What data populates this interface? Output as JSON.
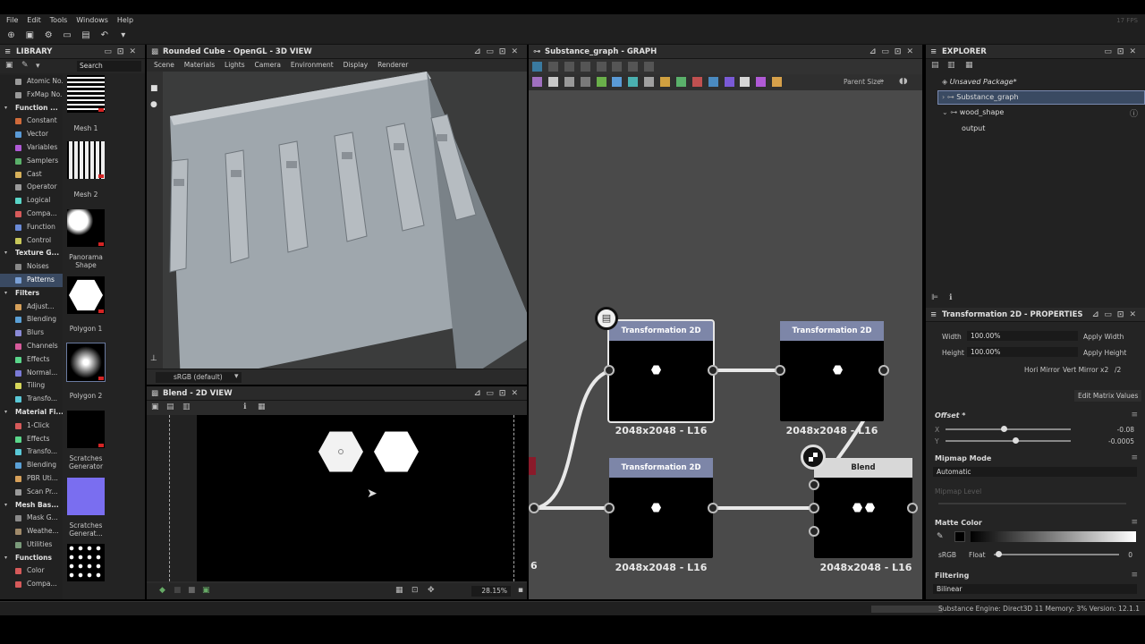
{
  "app": {
    "fps": "17 FPS"
  },
  "menu": [
    "File",
    "Edit",
    "Tools",
    "Windows",
    "Help"
  ],
  "library": {
    "title": "LIBRARY",
    "search_placeholder": "Search",
    "tree": [
      {
        "label": "Atomic No...",
        "type": "item",
        "color": "#9a9a9a"
      },
      {
        "label": "FxMap No...",
        "type": "item",
        "color": "#9a9a9a"
      },
      {
        "label": "Function ...",
        "type": "cat"
      },
      {
        "label": "Constant",
        "type": "item",
        "color": "#d06a3a"
      },
      {
        "label": "Vector",
        "type": "item",
        "color": "#5a9ad6"
      },
      {
        "label": "Variables",
        "type": "item",
        "color": "#b05ad6"
      },
      {
        "label": "Samplers",
        "type": "item",
        "color": "#5ab06a"
      },
      {
        "label": "Cast",
        "type": "item",
        "color": "#d6b05a"
      },
      {
        "label": "Operator",
        "type": "item",
        "color": "#9a9a9a"
      },
      {
        "label": "Logical",
        "type": "item",
        "color": "#5ad6c8"
      },
      {
        "label": "Compa...",
        "type": "item",
        "color": "#d65a5a"
      },
      {
        "label": "Function",
        "type": "item",
        "color": "#6a8ad6"
      },
      {
        "label": "Control",
        "type": "item",
        "color": "#c8c85a"
      },
      {
        "label": "Texture G...",
        "type": "cat"
      },
      {
        "label": "Noises",
        "type": "item",
        "color": "#888888"
      },
      {
        "label": "Patterns",
        "type": "item",
        "color": "#7aa0d6",
        "selected": true
      },
      {
        "label": "Filters",
        "type": "cat"
      },
      {
        "label": "Adjust...",
        "type": "item",
        "color": "#d6a05a"
      },
      {
        "label": "Blending",
        "type": "item",
        "color": "#5aa0d6"
      },
      {
        "label": "Blurs",
        "type": "item",
        "color": "#8a8ad6"
      },
      {
        "label": "Channels",
        "type": "item",
        "color": "#d65a9a"
      },
      {
        "label": "Effects",
        "type": "item",
        "color": "#5ad68a"
      },
      {
        "label": "Normal...",
        "type": "item",
        "color": "#7a7ad6"
      },
      {
        "label": "Tiling",
        "type": "item",
        "color": "#d6d65a"
      },
      {
        "label": "Transfo...",
        "type": "item",
        "color": "#5ac8d6"
      },
      {
        "label": "Material Fi...",
        "type": "cat"
      },
      {
        "label": "1-Click",
        "type": "item",
        "color": "#d65a5a"
      },
      {
        "label": "Effects",
        "type": "item",
        "color": "#5ad68a"
      },
      {
        "label": "Transfo...",
        "type": "item",
        "color": "#5ac8d6"
      },
      {
        "label": "Blending",
        "type": "item",
        "color": "#5aa0d6"
      },
      {
        "label": "PBR Uti...",
        "type": "item",
        "color": "#d6a05a"
      },
      {
        "label": "Scan Pr...",
        "type": "item",
        "color": "#9a9a9a"
      },
      {
        "label": "Mesh Bas...",
        "type": "cat"
      },
      {
        "label": "Mask G...",
        "type": "item",
        "color": "#8a8a8a"
      },
      {
        "label": "Weathe...",
        "type": "item",
        "color": "#a08a6a"
      },
      {
        "label": "Utilities",
        "type": "item",
        "color": "#7a9a7a"
      },
      {
        "label": "Functions",
        "type": "cat"
      },
      {
        "label": "Color",
        "type": "item",
        "color": "#d65a5a"
      },
      {
        "label": "Compa...",
        "type": "item",
        "color": "#d65a5a"
      }
    ],
    "thumbnails": [
      {
        "label": "Mesh 1"
      },
      {
        "label": "Mesh 2"
      },
      {
        "label": "Panorama Shape"
      },
      {
        "label": "Polygon 1"
      },
      {
        "label": "Polygon 2"
      },
      {
        "label": "Scratches Generator"
      },
      {
        "label": "Scratches Generat..."
      }
    ]
  },
  "view3d": {
    "title": "Rounded Cube - OpenGL - 3D VIEW",
    "menu": [
      "Scene",
      "Materials",
      "Lights",
      "Camera",
      "Environment",
      "Display",
      "Renderer"
    ],
    "colorspace": "sRGB (default)"
  },
  "view2d": {
    "title": "Blend - 2D VIEW",
    "zoom": "28.15%"
  },
  "graph": {
    "title": "Substance_graph - GRAPH",
    "parent_size_label": "Parent Size:",
    "edge_label": "6",
    "nodes": [
      {
        "title": "Transformation 2D",
        "size": "2048x2048 - L16"
      },
      {
        "title": "Transformation 2D",
        "size": "2048x2048 - L16"
      },
      {
        "title": "Transformation 2D",
        "size": "2048x2048 - L16"
      },
      {
        "title": "Blend",
        "size": "2048x2048 - L16"
      }
    ]
  },
  "explorer": {
    "title": "EXPLORER",
    "package": "Unsaved Package*",
    "items": [
      "Substance_graph",
      "wood_shape",
      "output"
    ]
  },
  "properties": {
    "title": "Transformation 2D - PROPERTIES",
    "width_label": "Width",
    "width_value": "100.00%",
    "apply_width": "Apply Width",
    "height_label": "Height",
    "height_value": "100.00%",
    "apply_height": "Apply Height",
    "mirror": [
      "Hori Mirror",
      "Vert Mirror",
      "x2",
      "/2"
    ],
    "edit_matrix": "Edit Matrix Values",
    "offset_label": "Offset *",
    "offset_x_label": "X",
    "offset_x": "-0.08",
    "offset_y_label": "Y",
    "offset_y": "-0.0005",
    "mipmap_mode_label": "Mipmap Mode",
    "mipmap_mode_value": "Automatic",
    "mipmap_level_label": "Mipmap Level",
    "matte_color_label": "Matte Color",
    "matte_srgb": "sRGB",
    "matte_float": "Float",
    "matte_value": "0",
    "filtering_label": "Filtering",
    "filtering_value": "Bilinear"
  },
  "status": "Substance Engine: Direct3D 11  Memory: 3%        Version: 12.1.1"
}
